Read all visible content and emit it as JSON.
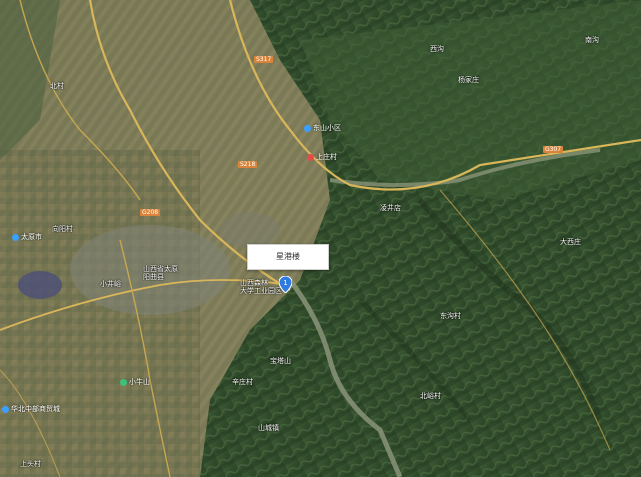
{
  "map": {
    "callout_label": "星港楼",
    "marker_number": "1",
    "colors": {
      "road": "#d9b65a",
      "river": "#8a9478",
      "poi_blue": "#3aa0ff",
      "poi_red": "#e34b4b",
      "poi_green": "#3cc07a",
      "marker": "#2f7be2"
    },
    "places": [
      {
        "label": "山西省太原",
        "label2": "阳曲县"
      },
      {
        "label": "山西森林",
        "label2": "大学工业园区"
      },
      {
        "label": "东山小区"
      },
      {
        "label": "宝塔山"
      },
      {
        "label": "小牛山"
      },
      {
        "label": "太原市"
      },
      {
        "label": "凌井店"
      },
      {
        "label": "杨家庄"
      },
      {
        "label": "大西庄"
      },
      {
        "label": "东沟村"
      },
      {
        "label": "北峪村"
      },
      {
        "label": "上庄村"
      },
      {
        "label": "山城镇"
      },
      {
        "label": "辛庄村"
      },
      {
        "label": "小井峪"
      },
      {
        "label": "向阳村"
      },
      {
        "label": "北村"
      },
      {
        "label": "西沟"
      },
      {
        "label": "南沟"
      },
      {
        "label": "上头村"
      }
    ],
    "road_tags": [
      "G208",
      "S317",
      "G307",
      "S218"
    ],
    "bottom_left_poi": "华北中部商贸城"
  }
}
